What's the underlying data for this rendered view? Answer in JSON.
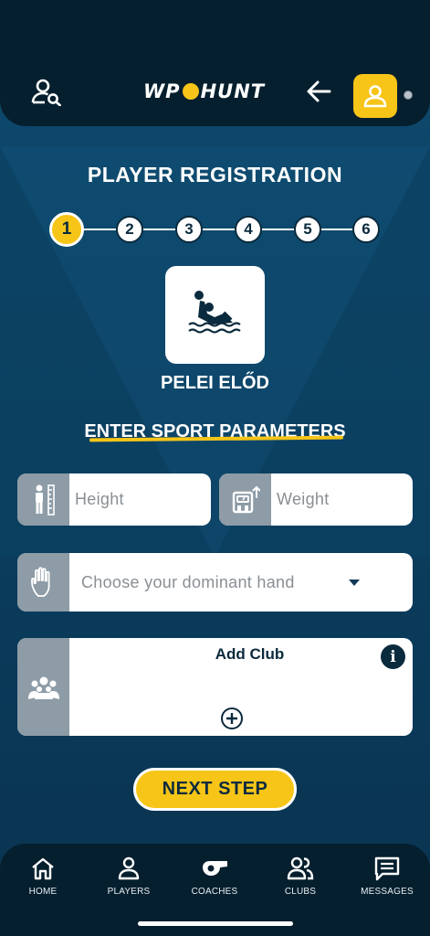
{
  "header": {
    "logo_left": "WP",
    "logo_right": "HUNT",
    "search_player_icon": "person-search-icon",
    "back_icon": "arrow-left-icon",
    "profile_icon": "user-icon"
  },
  "page": {
    "title": "PLAYER REGISTRATION",
    "steps": [
      "1",
      "2",
      "3",
      "4",
      "5",
      "6"
    ],
    "active_step": 1,
    "sport_icon": "water-polo-icon",
    "player_name": "PELEI ELŐD",
    "section_title": "ENTER SPORT PARAMETERS"
  },
  "form": {
    "height_placeholder": "Height",
    "weight_placeholder": "Weight",
    "hand_placeholder": "Choose your dominant hand",
    "club_title": "Add Club",
    "info_label": "i"
  },
  "actions": {
    "next_label": "NEXT STEP"
  },
  "tabs": [
    {
      "label": "HOME",
      "icon": "home-icon"
    },
    {
      "label": "PLAYERS",
      "icon": "person-icon"
    },
    {
      "label": "COACHES",
      "icon": "whistle-icon"
    },
    {
      "label": "CLUBS",
      "icon": "group-icon"
    },
    {
      "label": "MESSAGES",
      "icon": "message-icon"
    }
  ],
  "colors": {
    "accent": "#f6c518",
    "header_bg": "#061f2e",
    "page_bg": "#0b3f60",
    "icon_box": "#8d9ca6",
    "text_dark": "#0a2a3d"
  }
}
